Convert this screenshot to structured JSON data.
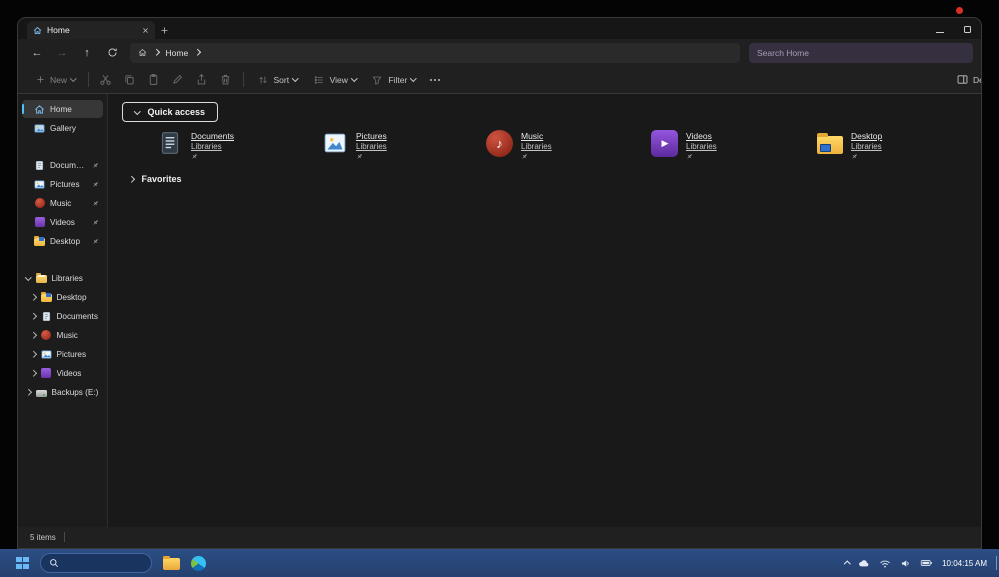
{
  "icons": {
    "back": "←",
    "forward": "→",
    "up": "↑",
    "music_note": "♪",
    "play": "▶"
  },
  "window": {
    "tab_title": "Home"
  },
  "navbar": {
    "breadcrumb_root": "Home",
    "search_placeholder": "Search Home"
  },
  "toolbar": {
    "new": "New",
    "sort": "Sort",
    "view": "View",
    "filter": "Filter",
    "details": "Details"
  },
  "sidebar": {
    "items": [
      {
        "label": "Home"
      },
      {
        "label": "Gallery"
      },
      {
        "label": "Documents"
      },
      {
        "label": "Pictures"
      },
      {
        "label": "Music"
      },
      {
        "label": "Videos"
      },
      {
        "label": "Desktop"
      },
      {
        "label": "Libraries"
      },
      {
        "label": "Desktop"
      },
      {
        "label": "Documents"
      },
      {
        "label": "Music"
      },
      {
        "label": "Pictures"
      },
      {
        "label": "Videos"
      },
      {
        "label": "Backups (E:)"
      }
    ]
  },
  "main": {
    "quick_access_label": "Quick access",
    "favorites_label": "Favorites",
    "quick_access_items": [
      {
        "name": "Documents",
        "location": "Libraries"
      },
      {
        "name": "Pictures",
        "location": "Libraries"
      },
      {
        "name": "Music",
        "location": "Libraries"
      },
      {
        "name": "Videos",
        "location": "Libraries"
      },
      {
        "name": "Desktop",
        "location": "Libraries"
      }
    ]
  },
  "statusbar": {
    "items_count": "5 items"
  },
  "taskbar": {
    "clock": "10:04:15 AM"
  }
}
